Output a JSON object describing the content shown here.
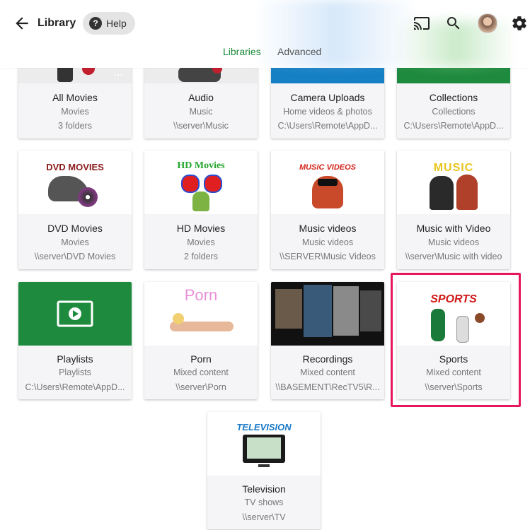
{
  "header": {
    "title": "Library",
    "help_label": "Help",
    "help_glyph": "?",
    "icons": [
      "back-arrow-icon",
      "cast-icon",
      "search-icon",
      "avatar",
      "gear-icon"
    ]
  },
  "tabs": [
    {
      "label": "Libraries",
      "active": true
    },
    {
      "label": "Advanced",
      "active": false
    }
  ],
  "libraries": [
    {
      "name": "All Movies",
      "type": "Movies",
      "path": "3 folders"
    },
    {
      "name": "Audio",
      "type": "Music",
      "path": "\\\\server\\Music"
    },
    {
      "name": "Camera Uploads",
      "type": "Home videos & photos",
      "path": "C:\\Users\\Remote\\AppD..."
    },
    {
      "name": "Collections",
      "type": "Collections",
      "path": "C:\\Users\\Remote\\AppD..."
    },
    {
      "name": "DVD Movies",
      "type": "Movies",
      "path": "\\\\server\\DVD Movies",
      "art_text": "DVD MOVIES"
    },
    {
      "name": "HD Movies",
      "type": "Movies",
      "path": "2 folders",
      "art_text": "HD Movies"
    },
    {
      "name": "Music videos",
      "type": "Music videos",
      "path": "\\\\SERVER\\Music Videos",
      "art_text": "MUSIC VIDEOS"
    },
    {
      "name": "Music with Video",
      "type": "Music videos",
      "path": "\\\\server\\Music with video",
      "art_text": "MUSIC"
    },
    {
      "name": "Playlists",
      "type": "Playlists",
      "path": "C:\\Users\\Remote\\AppD..."
    },
    {
      "name": "Porn",
      "type": "Mixed content",
      "path": "\\\\server\\Porn",
      "art_text": "Porn"
    },
    {
      "name": "Recordings",
      "type": "Mixed content",
      "path": "\\\\BASEMENT\\RecTV5\\R..."
    },
    {
      "name": "Sports",
      "type": "Mixed content",
      "path": "\\\\server\\Sports",
      "art_text": "SPORTS",
      "highlighted": true
    },
    {
      "name": "Television",
      "type": "TV shows",
      "path": "\\\\server\\TV",
      "art_text": "TELEVISION"
    }
  ],
  "colors": {
    "accent": "#1a8a3a",
    "highlight": "#e8175d",
    "playlist_tile": "#1e8a3e",
    "camera_tile": "#1580c4",
    "collections_tile": "#1e8a3e"
  }
}
